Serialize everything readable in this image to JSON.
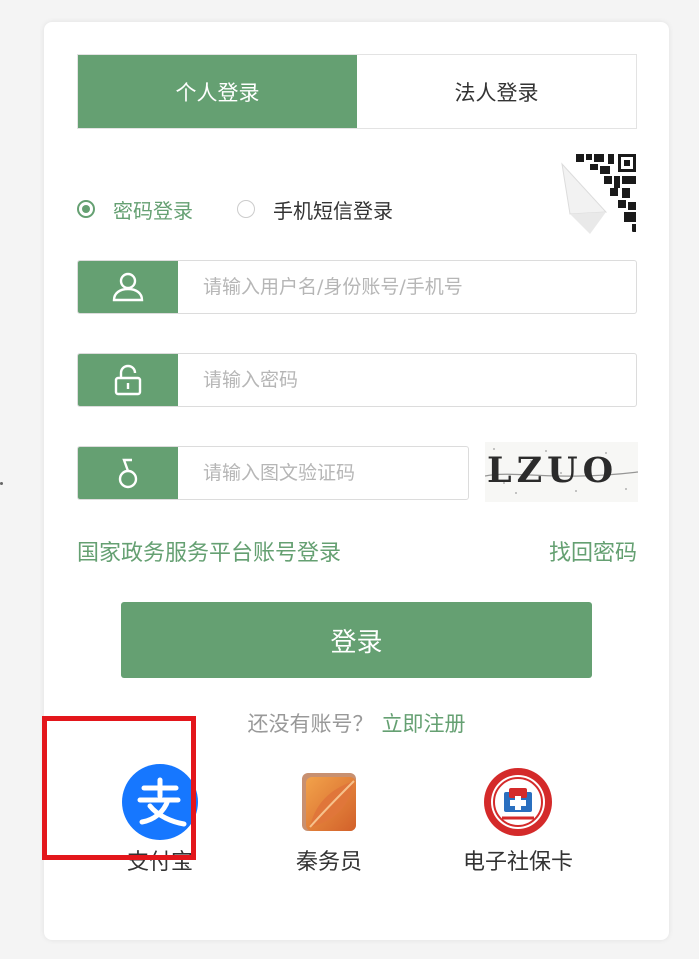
{
  "tabs": {
    "personal": "个人登录",
    "legal": "法人登录"
  },
  "login_modes": {
    "password": "密码登录",
    "sms": "手机短信登录"
  },
  "fields": {
    "username_placeholder": "请输入用户名/身份账号/手机号",
    "password_placeholder": "请输入密码",
    "captcha_placeholder": "请输入图文验证码"
  },
  "captcha": {
    "text": "LZUO"
  },
  "links": {
    "gov_platform": "国家政务服务平台账号登录",
    "forgot_password": "找回密码"
  },
  "login_button": "登录",
  "register": {
    "question": "还没有账号？",
    "link": "立即注册"
  },
  "third_party": [
    {
      "label": "支付宝",
      "icon": "alipay-icon"
    },
    {
      "label": "秦务员",
      "icon": "qinwuyuan-icon"
    },
    {
      "label": "电子社保卡",
      "icon": "social-security-card-icon"
    }
  ],
  "colors": {
    "accent": "#65a072",
    "highlight": "#e3161b",
    "alipay_blue": "#1677ff"
  }
}
